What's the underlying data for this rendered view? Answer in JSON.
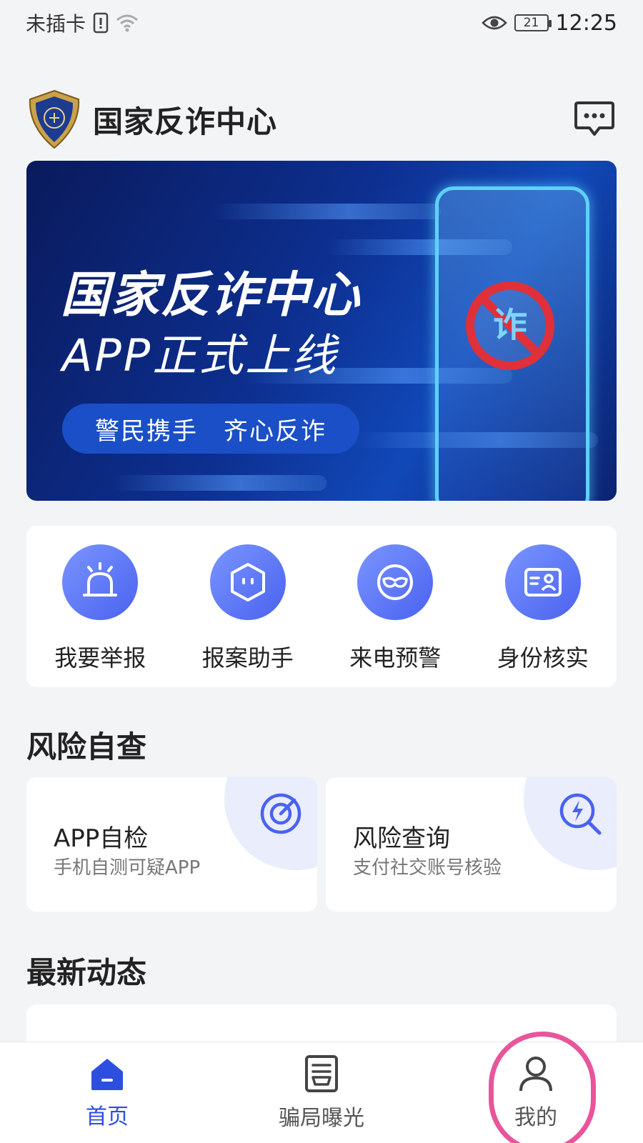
{
  "status_bar": {
    "carrier": "未插卡",
    "battery": "21",
    "time": "12:25",
    "icons": [
      "sim-alert-icon",
      "wifi-icon",
      "eye-icon",
      "battery-icon"
    ]
  },
  "header": {
    "title": "国家反诈中心",
    "logo_icon": "police-badge-icon",
    "message_icon": "message-icon"
  },
  "banner": {
    "title": "国家反诈中心",
    "subtitle": "APP正式上线",
    "slogan": "警民携手　齐心反诈",
    "badge_text": "诈"
  },
  "quick_actions": [
    {
      "label": "我要举报",
      "icon": "alarm-light-icon"
    },
    {
      "label": "报案助手",
      "icon": "robot-hexagon-icon"
    },
    {
      "label": "来电预警",
      "icon": "mask-icon"
    },
    {
      "label": "身份核实",
      "icon": "id-card-icon"
    }
  ],
  "sections": {
    "risk_check": "风险自查",
    "latest_news": "最新动态"
  },
  "risk_cards": [
    {
      "title": "APP自检",
      "desc": "手机自测可疑APP",
      "icon": "target-icon"
    },
    {
      "title": "风险查询",
      "desc": "支付社交账号核验",
      "icon": "search-lightning-icon"
    }
  ],
  "bottom_nav": [
    {
      "label": "首页",
      "icon": "home-icon",
      "active": true
    },
    {
      "label": "骗局曝光",
      "icon": "newspaper-icon",
      "active": false
    },
    {
      "label": "我的",
      "icon": "user-icon",
      "active": false
    }
  ],
  "colors": {
    "accent": "#2d4fe0",
    "icon_gradient_start": "#7a95ff",
    "icon_gradient_end": "#4a62ef",
    "highlight_ring": "#e8559b",
    "banner_dark": "#0a1a5c"
  }
}
